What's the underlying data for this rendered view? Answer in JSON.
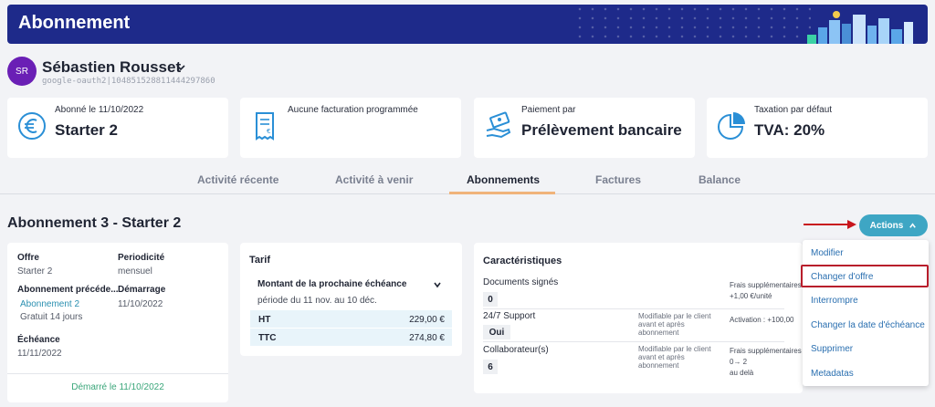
{
  "header": {
    "title": "Abonnement"
  },
  "user": {
    "initials": "SR",
    "name": "Sébastien Rousset",
    "id": "google-oauth2|104851528811444297860"
  },
  "summary": [
    {
      "icon": "euro-icon",
      "label": "Abonné le 11/10/2022",
      "value": "Starter 2"
    },
    {
      "icon": "invoice-icon",
      "label": "Aucune facturation programmée",
      "value": ""
    },
    {
      "icon": "payment-icon",
      "label": "Paiement par",
      "value": "Prélèvement bancaire"
    },
    {
      "icon": "pie-chart-icon",
      "label": "Taxation par défaut",
      "value": "TVA: 20%"
    }
  ],
  "tabs": [
    "Activité récente",
    "Activité à venir",
    "Abonnements",
    "Factures",
    "Balance"
  ],
  "active_tab": "Abonnements",
  "subscription": {
    "title": "Abonnement 3 - Starter 2",
    "actions_label": "Actions"
  },
  "offre": {
    "offre_label": "Offre",
    "offre_value": "Starter 2",
    "periodicite_label": "Periodicité",
    "periodicite_value": "mensuel",
    "previous_label": "Abonnement précéde...",
    "previous_link": "Abonnement 2",
    "previous_note": "Gratuit 14 jours",
    "demarrage_label": "Démarrage",
    "demarrage_value": "11/10/2022",
    "echeance_label": "Échéance",
    "echeance_value": "11/11/2022",
    "started": "Démarré le 11/10/2022"
  },
  "tarif": {
    "title": "Tarif",
    "next_label": "Montant de la prochaine échéance",
    "period": "période du 11 nov. au 10 déc.",
    "ht_label": "HT",
    "ht_value": "229,00 €",
    "ttc_label": "TTC",
    "ttc_value": "274,80 €"
  },
  "caracteristiques": {
    "title": "Caractéristiques",
    "docs_label": "Documents signés",
    "docs_value": "0",
    "docs_extra_1": "Frais supplémentaires",
    "docs_extra_2": "+1,00 €/unité",
    "support_label": "24/7 Support",
    "support_value": "Oui",
    "support_note": "Modifiable par le client avant et après abonnement",
    "support_extra": "Activation : +100,00",
    "collab_label": "Collaborateur(s)",
    "collab_value": "6",
    "collab_note": "Modifiable par le client avant et après abonnement",
    "collab_extra_1": "Frais supplémentaires",
    "collab_extra_2": "0→ 2",
    "collab_extra_3": "au delà"
  },
  "menu": [
    "Modifier",
    "Changer d'offre",
    "Interrompre",
    "Changer la date d'échéance",
    "Supprimer",
    "Metadatas"
  ],
  "colors": {
    "banner": "#1e2a8a",
    "accent": "#3ea6c4",
    "highlight": "#b81d2b",
    "tab_underline": "#f0b37a"
  }
}
